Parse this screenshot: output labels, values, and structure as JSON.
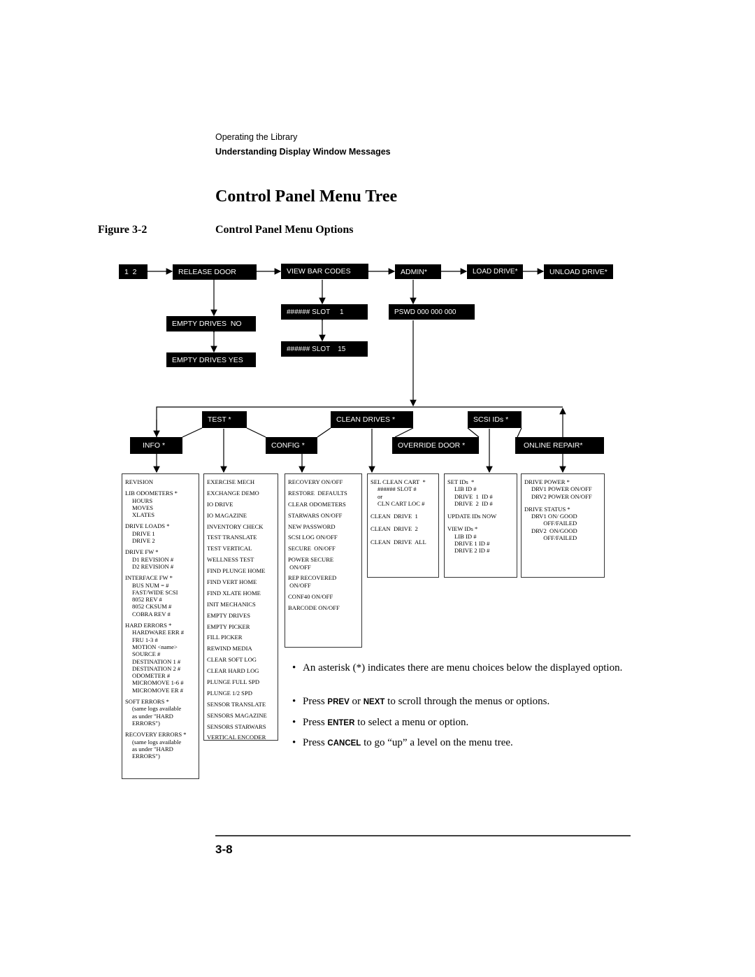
{
  "header": {
    "section": "Operating the Library",
    "subsection": "Understanding Display Window Messages"
  },
  "title": "Control Panel Menu Tree",
  "figure": {
    "number": "Figure 3-2",
    "caption": "Control Panel Menu Options"
  },
  "top_menu": {
    "start": "1  2",
    "release_door": "RELEASE DOOR",
    "view_bar_codes": "VIEW BAR CODES",
    "admin": "ADMIN*",
    "load_drive": "LOAD DRIVE*",
    "unload_drive": "UNLOAD DRIVE*"
  },
  "sub_menu": {
    "empty_no": "EMPTY DRIVES  NO",
    "empty_yes": "EMPTY DRIVES YES",
    "slot_1": "###### SLOT     1",
    "slot_15": "###### SLOT    15",
    "password": "PSWD 000 000 000"
  },
  "admin_menu": {
    "test": "TEST *",
    "clean_drives": "CLEAN DRIVES *",
    "scsi_ids": "SCSI IDs *",
    "info": "INFO *",
    "config": "CONFIG *",
    "override_door": "OVERRIDE DOOR *",
    "online_repair": "ONLINE REPAIR*"
  },
  "info_list": [
    [
      "REVISION"
    ],
    [
      "LIB ODOMETERS *",
      "HOURS",
      "MOVES",
      "XLATES"
    ],
    [
      "DRIVE LOADS *",
      "DRIVE 1",
      "DRIVE 2"
    ],
    [
      "DRIVE FW *",
      "D1 REVISION #",
      "D2 REVISION #"
    ],
    [
      "INTERFACE FW *",
      "BUS NUM = #",
      "FAST/WIDE SCSI",
      "8052 REV #",
      "8052 CKSUM #",
      "COBRA REV #"
    ],
    [
      "HARD ERRORS *",
      "HARDWARE ERR #",
      "FRU 1-3 #",
      "MOTION <name>",
      "SOURCE #",
      "DESTINATION 1 #",
      "DESTINATION 2 #",
      "ODOMETER #",
      "MICROMOVE 1-6 #",
      "MICROMOVE ER #"
    ],
    [
      "SOFT ERRORS *",
      "(same logs available",
      "as under \"HARD",
      "ERRORS\")"
    ],
    [
      "RECOVERY ERRORS *",
      "(same logs available",
      "as under \"HARD",
      "ERRORS\")"
    ]
  ],
  "test_list": [
    "EXERCISE MECH",
    "EXCHANGE DEMO",
    "IO DRIVE",
    "IO MAGAZINE",
    "INVENTORY CHECK",
    "TEST TRANSLATE",
    "TEST VERTICAL",
    "WELLNESS TEST",
    "FIND PLUNGE HOME",
    "FIND VERT HOME",
    "FIND XLATE HOME",
    "INIT MECHANICS",
    "EMPTY DRIVES",
    "EMPTY PICKER",
    "FILL PICKER",
    "REWIND MEDIA",
    "CLEAR SOFT LOG",
    "CLEAR HARD LOG",
    "PLUNGE FULL SPD",
    "PLUNGE 1/2 SPD",
    "SENSOR TRANSLATE",
    "SENSORS MAGAZINE",
    "SENSORS STARWARS",
    "VERTICAL ENCODER"
  ],
  "config_list": [
    "RECOVERY ON/OFF",
    "RESTORE  DEFAULTS",
    "CLEAR ODOMETERS",
    "STARWARS ON/OFF",
    "NEW PASSWORD",
    "SCSI LOG ON/OFF",
    "SECURE  ON/OFF",
    "POWER SECURE\n ON/OFF",
    "REP RECOVERED\n ON/OFF",
    "CONF40 ON/OFF",
    "BARCODE ON/OFF"
  ],
  "clean_list": [
    [
      "SEL CLEAN CART  *",
      "###### SLOT #",
      "or",
      "CLN CART LOC #"
    ],
    [
      "CLEAN  DRIVE  1"
    ],
    [
      "CLEAN  DRIVE  2"
    ],
    [
      "CLEAN  DRIVE  ALL"
    ]
  ],
  "scsi_list": [
    [
      "SET IDs  *",
      "LIB ID #",
      "DRIVE  1  ID #",
      "DRIVE  2  ID #"
    ],
    [
      "UPDATE IDs NOW"
    ],
    [
      "VIEW IDs *",
      "LIB ID #",
      "DRIVE 1 ID #",
      "DRIVE 2 ID #"
    ]
  ],
  "repair_list": [
    [
      "DRIVE POWER *",
      "DRV1 POWER ON/OFF",
      "DRV2 POWER ON/OFF"
    ],
    [
      "DRIVE STATUS *",
      "DRV1 ON/ GOOD",
      "        OFF/FAILED",
      "DRV2  ON/GOOD",
      "        OFF/FAILED"
    ]
  ],
  "notes": [
    {
      "parts": [
        {
          "t": "An asterisk (*) indicates there are menu choices below the displayed option."
        }
      ]
    },
    {
      "parts": [
        {
          "t": "Press "
        },
        {
          "t": "PREV",
          "kw": true
        },
        {
          "t": " or "
        },
        {
          "t": "NEXT",
          "kw": true
        },
        {
          "t": " to scroll through the menus or options."
        }
      ]
    },
    {
      "parts": [
        {
          "t": "Press "
        },
        {
          "t": "ENTER",
          "kw": true
        },
        {
          "t": " to select a menu or option."
        }
      ]
    },
    {
      "parts": [
        {
          "t": "Press "
        },
        {
          "t": "CANCEL",
          "kw": true
        },
        {
          "t": " to go “up” a level on the menu tree."
        }
      ]
    }
  ],
  "bullet": "•",
  "page_number": "3-8"
}
